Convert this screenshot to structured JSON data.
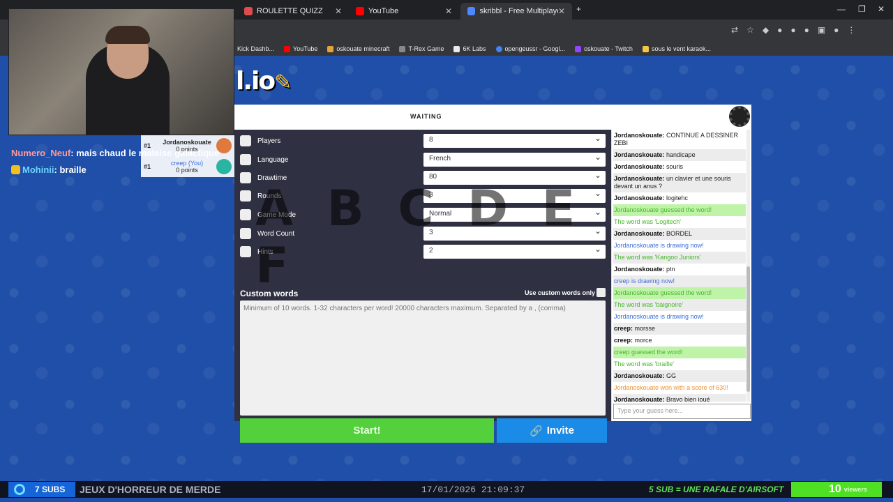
{
  "browser": {
    "tabs": [
      {
        "label": "",
        "color": "#888"
      },
      {
        "label": "",
        "color": "#888"
      },
      {
        "label": "ROULETTE QUIZZ",
        "color": "#e04b4b"
      },
      {
        "label": "YouTube",
        "color": "#ff0000"
      },
      {
        "label": "skribbl - Free Multiplayer Draw",
        "color": "#4f87ff"
      }
    ],
    "bookmarks": [
      {
        "label": "Kick Dashb...",
        "color": "#53fc18"
      },
      {
        "label": "YouTube",
        "color": "#ff0000"
      },
      {
        "label": "oskouate minecraft",
        "color": "#e4a23a"
      },
      {
        "label": "T-Rex Game",
        "color": "#888"
      },
      {
        "label": "6K Labs",
        "color": "#e8eaed"
      },
      {
        "label": "opengeussr - Googl...",
        "color": "#4285f4"
      },
      {
        "label": "oskouate - Twitch",
        "color": "#9146ff"
      },
      {
        "label": "sous le vent karaok...",
        "color": "#f2c744"
      }
    ]
  },
  "overlay_chat": [
    {
      "name": "Numero_Neuf",
      "text": ": mais chaud le malaise galactique"
    },
    {
      "name": "Mohinii",
      "text": ": braille"
    }
  ],
  "players": [
    {
      "rank": "#1",
      "name": "Jordanoskouate",
      "points": "0 points"
    },
    {
      "rank": "#1",
      "name": "creep (You)",
      "points": "0 points"
    }
  ],
  "game": {
    "logo": "l.io",
    "status": "WAITING",
    "letters": "A B C D E F",
    "settings": [
      {
        "label": "Players",
        "value": "8",
        "icon": "user-icon"
      },
      {
        "label": "Language",
        "value": "French",
        "icon": "book-icon"
      },
      {
        "label": "Drawtime",
        "value": "80",
        "icon": "clock-icon"
      },
      {
        "label": "Rounds",
        "value": "3",
        "icon": "cloud-icon"
      },
      {
        "label": "Game Mode",
        "value": "Normal",
        "icon": "controller-icon"
      },
      {
        "label": "Word Count",
        "value": "3",
        "icon": "list-icon"
      },
      {
        "label": "Hints",
        "value": "2",
        "icon": "question-icon"
      }
    ],
    "custom_words_label": "Custom words",
    "custom_words_only_label": "Use custom words only",
    "custom_words_placeholder": "Minimum of 10 words. 1-32 characters per word! 20000 characters maximum. Separated by a , (comma)",
    "start_label": "Start!",
    "invite_label": "Invite"
  },
  "chat": {
    "messages": [
      {
        "type": "normal",
        "name": "Jordanoskouate:",
        "text": "CONTINUE A DESSINER ZEBI"
      },
      {
        "type": "normal",
        "name": "Jordanoskouate:",
        "text": "handicape"
      },
      {
        "type": "normal",
        "name": "Jordanoskouate:",
        "text": "souris"
      },
      {
        "type": "normal",
        "name": "Jordanoskouate:",
        "text": "un clavier et une souris devant un anus ?"
      },
      {
        "type": "normal",
        "name": "Jordanoskouate:",
        "text": "logitehc"
      },
      {
        "type": "green",
        "name": "",
        "text": "Jordanoskouate guessed the word!"
      },
      {
        "type": "guessed",
        "name": "",
        "text": "The word was 'Logitech'"
      },
      {
        "type": "normal",
        "name": "Jordanoskouate:",
        "text": "BORDEL"
      },
      {
        "type": "blue",
        "name": "",
        "text": "Jordanoskouate is drawing now!"
      },
      {
        "type": "guessed",
        "name": "",
        "text": "The word was 'Kangoo Juniors'"
      },
      {
        "type": "normal",
        "name": "Jordanoskouate:",
        "text": "ptn"
      },
      {
        "type": "blue",
        "name": "",
        "text": "creep is drawing now!"
      },
      {
        "type": "green",
        "name": "",
        "text": "Jordanoskouate guessed the word!"
      },
      {
        "type": "guessed",
        "name": "",
        "text": "The word was 'baignoire'"
      },
      {
        "type": "blue",
        "name": "",
        "text": "Jordanoskouate is drawing now!"
      },
      {
        "type": "normal",
        "name": "creep:",
        "text": "morsse"
      },
      {
        "type": "normal",
        "name": "creep:",
        "text": "morce"
      },
      {
        "type": "green",
        "name": "",
        "text": "creep guessed the word!"
      },
      {
        "type": "guessed",
        "name": "",
        "text": "The word was 'braille'"
      },
      {
        "type": "normal",
        "name": "Jordanoskouate:",
        "text": "GG"
      },
      {
        "type": "orange",
        "name": "",
        "text": "Jordanoskouate won with a score of 630!"
      },
      {
        "type": "normal",
        "name": "Jordanoskouate:",
        "text": "Bravo bien joué"
      }
    ],
    "guess_placeholder": "Type your guess here..."
  },
  "stream": {
    "subs": "7 SUBS",
    "title": "JEUX D'HORREUR DE MERDE",
    "datetime": "17/01/2026 21:09:37",
    "promo": "5 SUB = UNE RAFALE D'AIRSOFT",
    "viewers": "10",
    "viewers_label": "viewers"
  }
}
